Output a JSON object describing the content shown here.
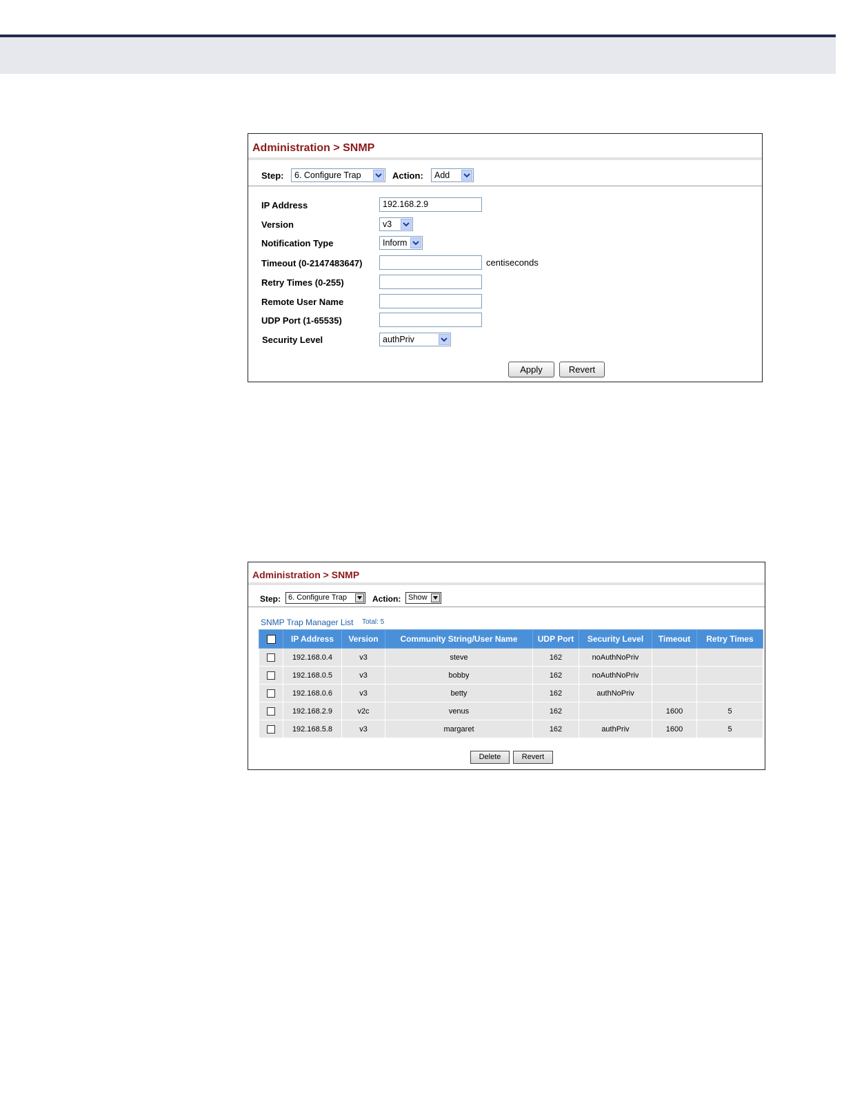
{
  "panel1": {
    "title": "Administration > SNMP",
    "step_label": "Step:",
    "step_value": "6. Configure Trap",
    "action_label": "Action:",
    "action_value": "Add",
    "fields": {
      "ip_address": {
        "label": "IP Address",
        "value": "192.168.2.9"
      },
      "version": {
        "label": "Version",
        "value": "v3"
      },
      "notification_type": {
        "label": "Notification Type",
        "value": "Inform"
      },
      "timeout": {
        "label": "Timeout (0-2147483647)",
        "value": "",
        "unit": "centiseconds"
      },
      "retry_times": {
        "label": "Retry Times (0-255)",
        "value": ""
      },
      "remote_user": {
        "label": "Remote User Name",
        "value": ""
      },
      "udp_port": {
        "label": "UDP Port (1-65535)",
        "value": ""
      },
      "security_level": {
        "label": "Security Level",
        "value": "authPriv"
      }
    },
    "apply_label": "Apply",
    "revert_label": "Revert"
  },
  "panel2": {
    "title": "Administration > SNMP",
    "step_label": "Step:",
    "step_value": "6. Configure Trap",
    "action_label": "Action:",
    "action_value": "Show",
    "list_title": "SNMP Trap Manager List",
    "total": "Total: 5",
    "columns": [
      "IP Address",
      "Version",
      "Community String/User Name",
      "UDP Port",
      "Security Level",
      "Timeout",
      "Retry Times"
    ],
    "rows": [
      [
        "192.168.0.4",
        "v3",
        "steve",
        "162",
        "noAuthNoPriv",
        "",
        ""
      ],
      [
        "192.168.0.5",
        "v3",
        "bobby",
        "162",
        "noAuthNoPriv",
        "",
        ""
      ],
      [
        "192.168.0.6",
        "v3",
        "betty",
        "162",
        "authNoPriv",
        "",
        ""
      ],
      [
        "192.168.2.9",
        "v2c",
        "venus",
        "162",
        "",
        "1600",
        "5"
      ],
      [
        "192.168.5.8",
        "v3",
        "margaret",
        "162",
        "authPriv",
        "1600",
        "5"
      ]
    ],
    "delete_label": "Delete",
    "revert_label": "Revert"
  }
}
